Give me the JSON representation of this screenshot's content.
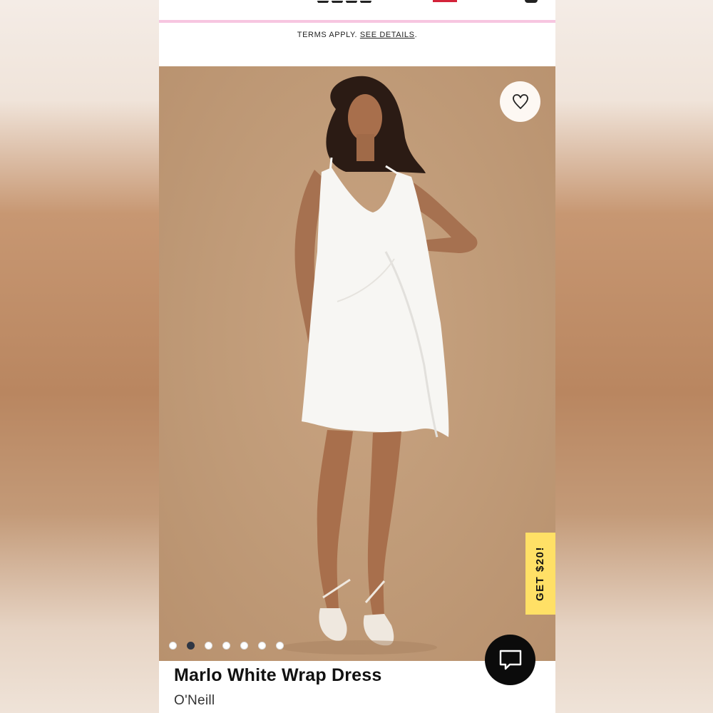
{
  "header": {
    "terms_text": "TERMS APPLY.",
    "terms_link": "SEE DETAILS",
    "terms_period": ".",
    "accent_color": "#f7c6e0"
  },
  "hero": {
    "wishlist_icon": "heart-icon",
    "promo_label": "GET $20!",
    "promo_color": "#ffe066",
    "carousel_total": 7,
    "carousel_active_index": 1
  },
  "product": {
    "name": "Marlo White Wrap Dress",
    "brand": "O'Neill"
  },
  "chat": {
    "icon": "chat-bubble-icon"
  }
}
